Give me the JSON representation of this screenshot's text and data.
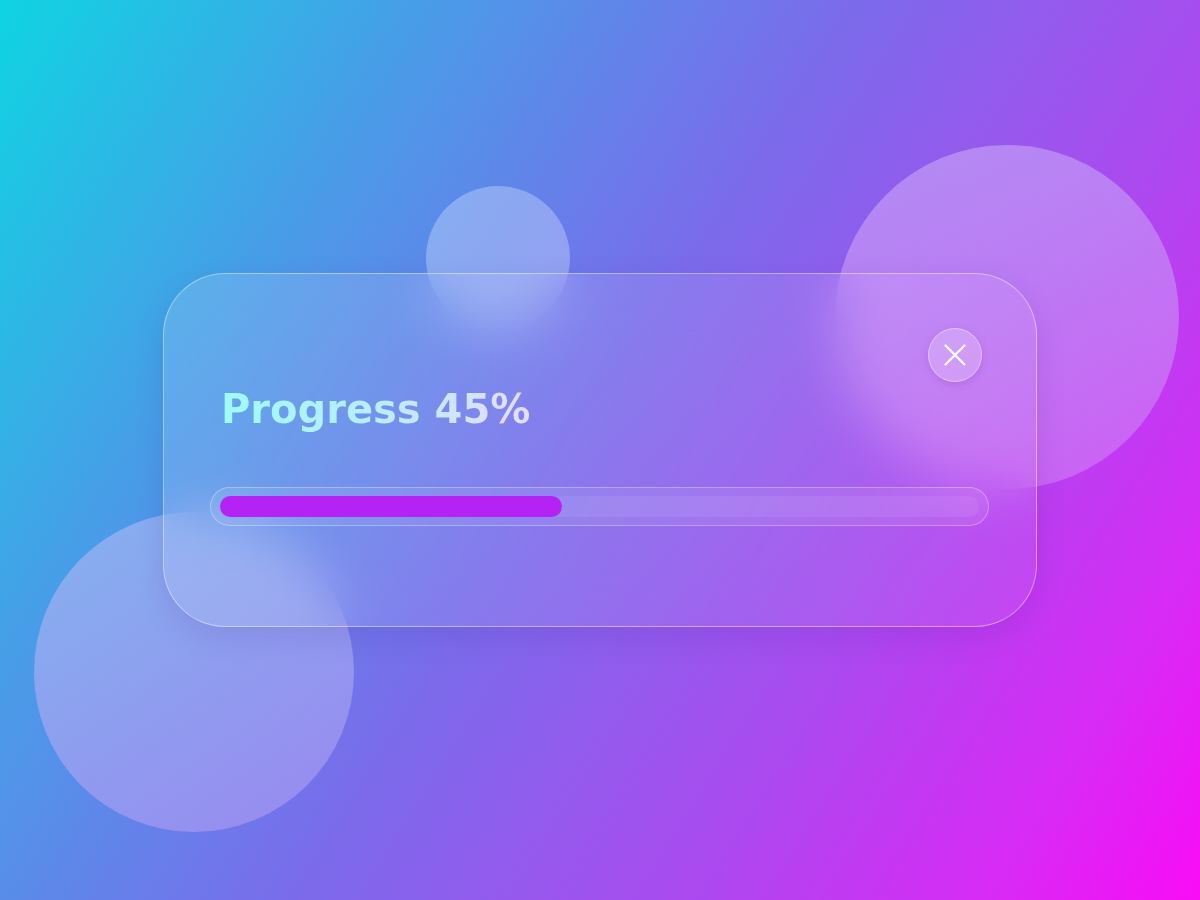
{
  "card": {
    "title": "Progress 45%",
    "progress": {
      "level": 0.45
    }
  }
}
